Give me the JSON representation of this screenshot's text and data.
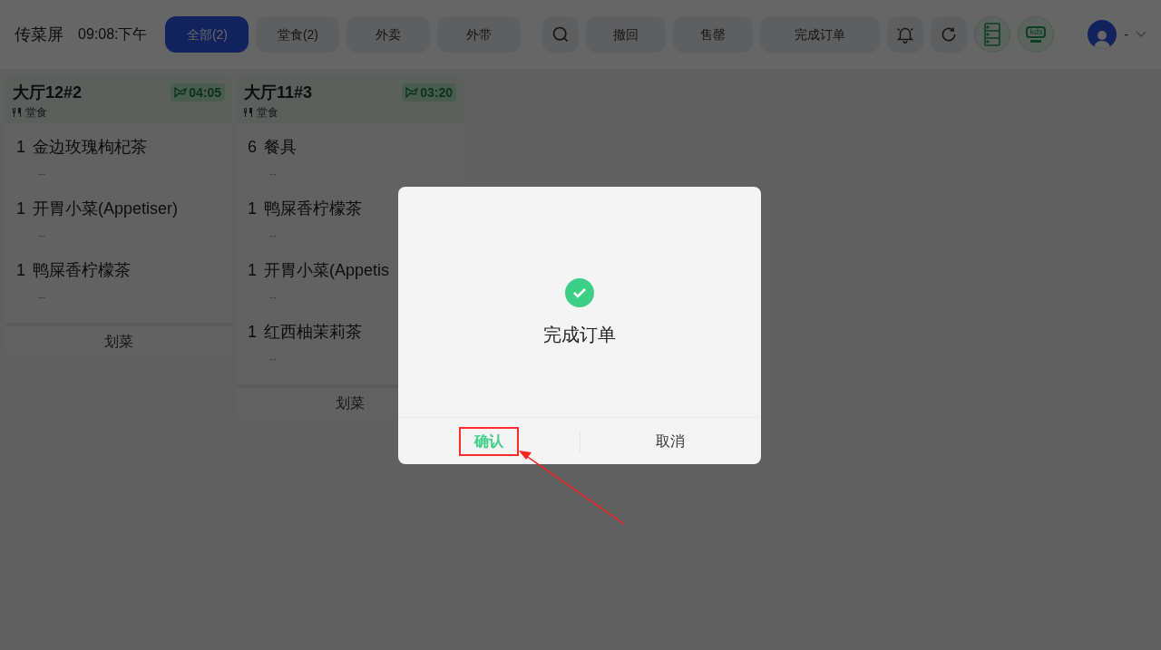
{
  "header": {
    "title": "传菜屏",
    "time": "09:08:下午",
    "user_label": "-"
  },
  "tabs": [
    {
      "label": "全部(2)",
      "selected": true
    },
    {
      "label": "堂食(2)",
      "selected": false
    },
    {
      "label": "外卖",
      "selected": false
    },
    {
      "label": "外带",
      "selected": false
    }
  ],
  "actions": [
    {
      "kind": "search"
    },
    {
      "kind": "text",
      "label": "撤回"
    },
    {
      "kind": "text",
      "label": "售罄"
    },
    {
      "kind": "wide_text",
      "label": "完成订单"
    },
    {
      "kind": "bell"
    },
    {
      "kind": "refresh"
    },
    {
      "kind": "server"
    },
    {
      "kind": "kds",
      "label": "kds"
    }
  ],
  "orders": [
    {
      "table": "大厅12#2",
      "timer": "04:05",
      "type": "堂食",
      "items": [
        {
          "qty": "1",
          "name": "金边玫瑰枸杞茶",
          "note": "--"
        },
        {
          "qty": "1",
          "name": "开胃小菜(Appetiser)",
          "note": "--"
        },
        {
          "qty": "1",
          "name": "鸭屎香柠檬茶",
          "note": "--"
        }
      ],
      "button": "划菜"
    },
    {
      "table": "大厅11#3",
      "timer": "03:20",
      "type": "堂食",
      "items": [
        {
          "qty": "6",
          "name": "餐具",
          "note": "--"
        },
        {
          "qty": "1",
          "name": "鸭屎香柠檬茶",
          "note": "--"
        },
        {
          "qty": "1",
          "name": "开胃小菜(Appetis",
          "note": "--"
        },
        {
          "qty": "1",
          "name": "红西柚茉莉茶",
          "note": "--"
        }
      ],
      "button": "划菜"
    }
  ],
  "dialog": {
    "message": "完成订单",
    "confirm": "确认",
    "cancel": "取消",
    "confirm_highlighted": true
  }
}
